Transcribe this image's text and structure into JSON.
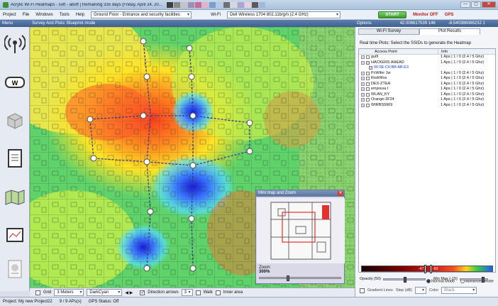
{
  "window": {
    "title": "Acrylic Wi-Fi Heatmaps - soft - aboff | Remaining 335 days (Friday, April 24, 20...",
    "controls": [
      "—",
      "▢",
      "✕"
    ]
  },
  "menu": {
    "items": [
      "Project",
      "File",
      "Windows",
      "Tools",
      "Help"
    ],
    "floor_selector": "Ground Floor - Entrance and security facilities",
    "wifi_label": "Wi-Fi",
    "adapter_selector": "Dell Wireless 1704 802.11b/g/n (2.4 GHz)",
    "start_button": "START",
    "monitor_status": "Monitor OFF",
    "gps_status": "GPS"
  },
  "panes": {
    "left": "Menu",
    "center": "Survey And Plots: Blueprint mode",
    "right": "Options",
    "coord_lat": "42.006617539 146",
    "coord_lon": "-8.540386086232 1"
  },
  "right_panel": {
    "tabs": [
      "Wi-Fi Survey",
      "Plot Results"
    ],
    "hint": "Real time Plots: Select the SSIDs to generate the Heatmap",
    "columns": [
      "Access Point",
      "Info"
    ],
    "rows": [
      {
        "name": "guifi",
        "info": "1 Aps | 1 / 0 (2.4 / 5 Ghz)",
        "sub": false,
        "checked": false
      },
      {
        "name": "HACKERS AHEAD",
        "info": "1 Aps | 1 / 0 (2.4 / 5 Ghz)",
        "sub": false,
        "checked": true
      },
      {
        "name": "00:0E:C6:BB:AB:E3",
        "info": "",
        "sub": true,
        "checked": true
      },
      {
        "name": "PcWifer Jw",
        "info": "1 Aps | 1 / 0 (2.4 / 5 Ghz)",
        "sub": false,
        "checked": false
      },
      {
        "name": "RodrMos",
        "info": "1 Aps | 1 / 0 (2.4 / 5 Ghz)",
        "sub": false,
        "checked": false
      },
      {
        "name": "DEX-ZTEA",
        "info": "1 Aps | 1 / 0 (2.4 / 5 Ghz)",
        "sub": false,
        "checked": false
      },
      {
        "name": "empresa I",
        "info": "1 Aps | 1 / 0 (2.4 / 5 Ghz)",
        "sub": false,
        "checked": false
      },
      {
        "name": "WLAN_KY",
        "info": "1 Aps | 1 / 0 (2.4 / 5 Ghz)",
        "sub": false,
        "checked": false
      },
      {
        "name": "Orange-3F24",
        "info": "1 Aps | 1 / 0 (2.4 / 5 Ghz)",
        "sub": false,
        "checked": false
      },
      {
        "name": "WIRBS9969",
        "info": "1 Aps | 1 / 0 (2.4 / 5 Ghz)",
        "sub": false,
        "checked": false
      }
    ],
    "mode_normal": "Normal Mode",
    "mode_advanced": "Advanced Mode",
    "gradient_marks": [
      "-47",
      "-50"
    ],
    "opacity_label": "Opacity (50)",
    "minmax_label": "Min Max (-15)",
    "gradient_lines_label": "Gradient Lines",
    "step_label": "Step (dB)",
    "color_label": "Color",
    "color_value": "Black"
  },
  "minimap": {
    "title": "Mini map and Zoom",
    "zoom_label": "Zoom:",
    "zoom_value": "300%"
  },
  "bottom_bar": {
    "grid_label": "Grid",
    "grid_value": "3 Meters",
    "color_value": "DarkCyan",
    "direction_label": "Direction arrows",
    "direction_value": "3",
    "walk_label": "Walk",
    "inner_label": "Inner area"
  },
  "statusbar": {
    "project": "Project: My new Project22",
    "points": "9 / 9 APs(s)",
    "gps": "GPS Status: Off"
  },
  "colors": {
    "accent": "#3e5f8f",
    "start": "#3b9a2e",
    "alert": "#c01818",
    "selected_ap": "#1a44d0"
  }
}
